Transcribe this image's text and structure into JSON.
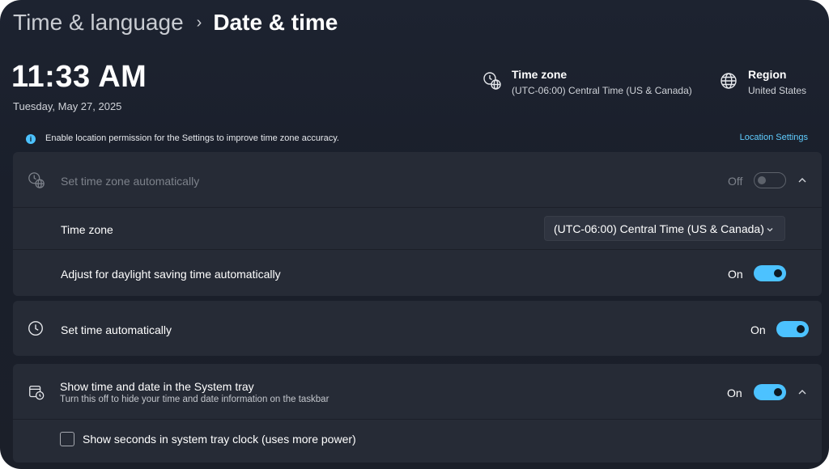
{
  "breadcrumb": {
    "parent": "Time & language",
    "separator": "›",
    "current": "Date & time"
  },
  "clock": {
    "time": "11:33 AM",
    "date": "Tuesday, May 27, 2025"
  },
  "summary": {
    "timezone": {
      "title": "Time zone",
      "value": "(UTC-06:00) Central Time (US & Canada)",
      "icon": "timezone-globe-icon"
    },
    "region": {
      "title": "Region",
      "value": "United States",
      "icon": "globe-icon"
    }
  },
  "banner": {
    "icon_glyph": "i",
    "text": "Enable location permission for the Settings to improve time zone accuracy.",
    "link": "Location Settings"
  },
  "timezone_section": {
    "set_auto": {
      "label": "Set time zone automatically",
      "state": "Off",
      "enabled": false
    },
    "timezone_row": {
      "label": "Time zone",
      "selected": "(UTC-06:00) Central Time (US & Canada)"
    },
    "dst_row": {
      "label": "Adjust for daylight saving time automatically",
      "state": "On",
      "enabled": true
    }
  },
  "set_time_auto": {
    "label": "Set time automatically",
    "state": "On",
    "enabled": true
  },
  "system_tray": {
    "label": "Show time and date in the System tray",
    "sublabel": "Turn this off to hide your time and date information on the taskbar",
    "state": "On",
    "enabled": true,
    "seconds_option": {
      "label": "Show seconds in system tray clock (uses more power)",
      "checked": false
    }
  },
  "colors": {
    "accent": "#4cc2ff",
    "link": "#60cdff",
    "card": "#262b36",
    "background": "#1d2330"
  }
}
